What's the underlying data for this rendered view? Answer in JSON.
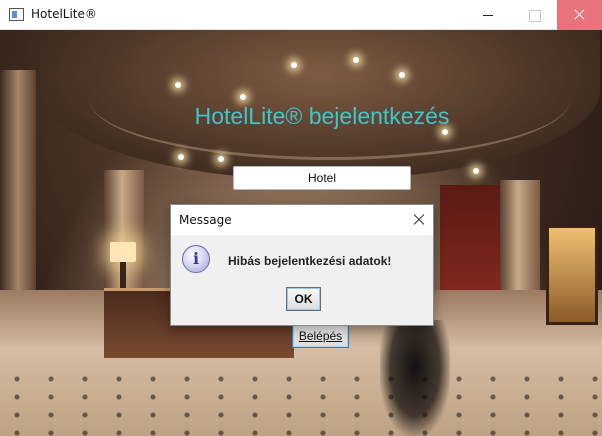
{
  "window": {
    "title": "HotelLite®"
  },
  "login": {
    "heading": "HotelLite® bejelentkezés",
    "hotel_value": "Hotel",
    "login_button_label": "Belépés"
  },
  "dialog": {
    "title": "Message",
    "message": "Hibás bejelentkezési adatok!",
    "ok_label": "OK",
    "icon": "info-icon"
  },
  "colors": {
    "heading": "#3ec6cf",
    "close_button": "#e8737d"
  }
}
